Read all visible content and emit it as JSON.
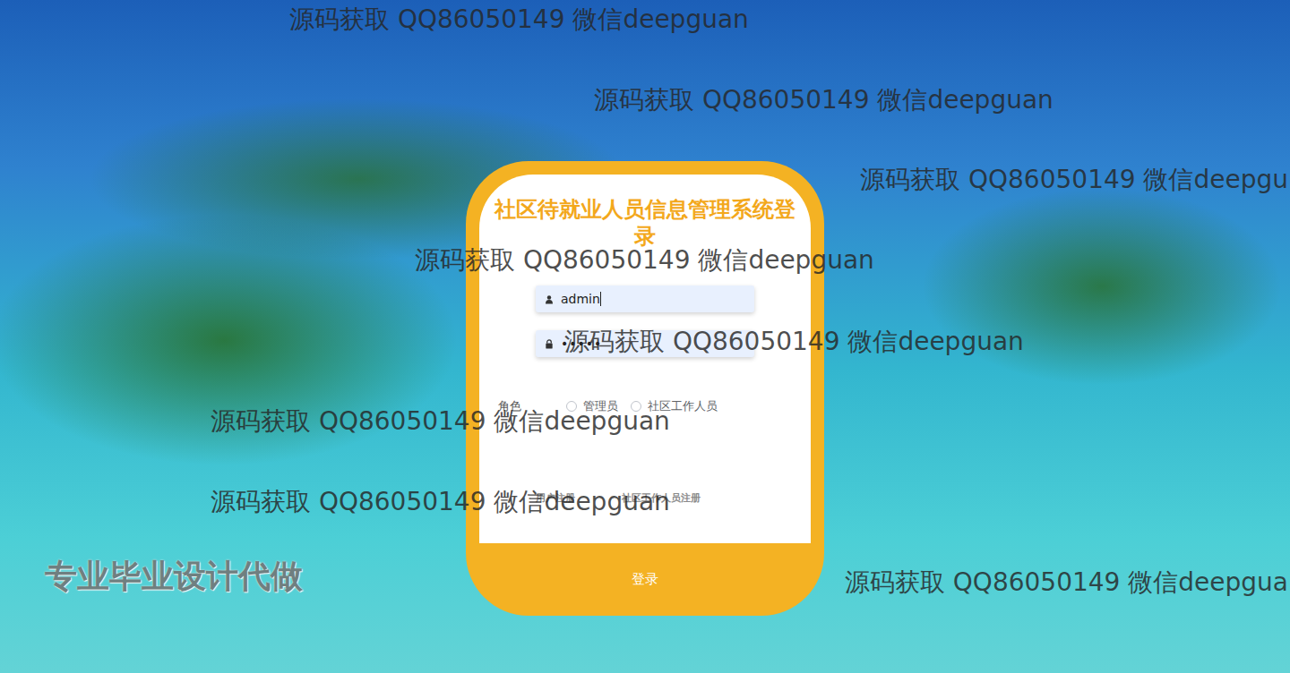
{
  "page": {
    "title": "社区待就业人员信息管理系统登录"
  },
  "form": {
    "username": {
      "value": "admin",
      "focused": true
    },
    "password": {
      "mask": "•••••"
    },
    "role": {
      "label": "角色",
      "options": [
        {
          "label": "管理员",
          "selected": false
        },
        {
          "label": "社区工作人员",
          "selected": false
        }
      ]
    },
    "links": [
      "用户注册",
      "社区工作人员注册"
    ],
    "submit": "登录"
  },
  "overlay": {
    "watermarks": [
      "源码获取 QQ86050149 微信deepguan",
      "源码获取 QQ86050149 微信deepguan",
      "源码获取 QQ86050149 微信deepgu",
      "源码获取 QQ86050149 微信deepguan",
      "源码获取 QQ86050149 微信deepguan",
      "源码获取 QQ86050149 微信deepguan",
      "源码获取 QQ86050149 微信deepguan",
      "源码获取 QQ86050149 微信deepgua"
    ],
    "banner": "专业毕业设计代做"
  }
}
